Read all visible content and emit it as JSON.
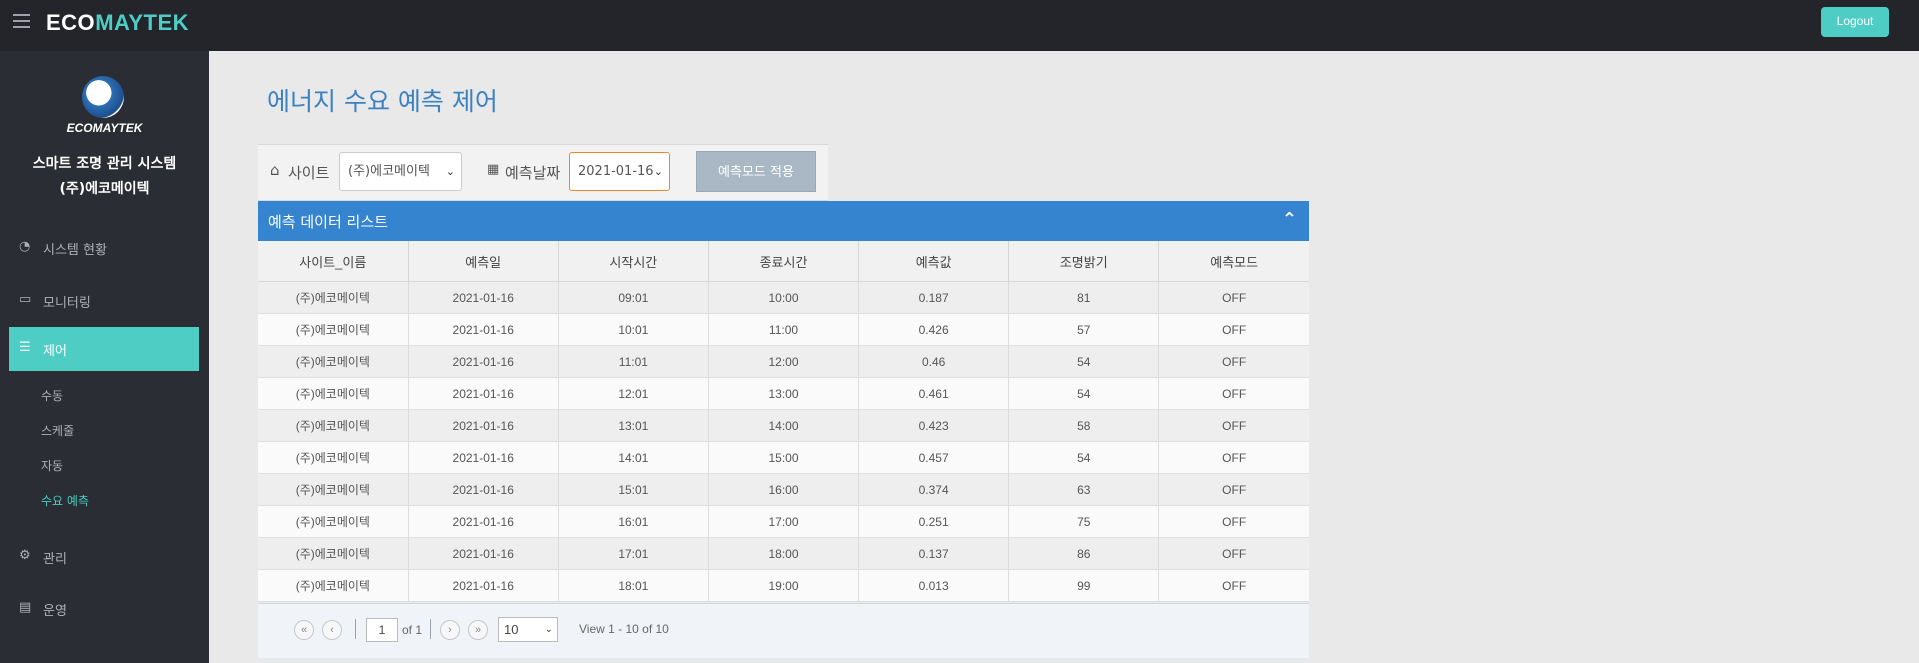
{
  "topbar": {
    "brand_eco": "ECO",
    "brand_maytek": "MAYTEK",
    "logout": "Logout"
  },
  "sidebar": {
    "logo_text": "ECOMAYTEK",
    "system_title": "스마트 조명 관리 시스템",
    "company": "(주)에코메이텍",
    "items": [
      {
        "label": "시스템 현황",
        "icon": "dashboard-icon"
      },
      {
        "label": "모니터링",
        "icon": "monitor-icon"
      },
      {
        "label": "제어",
        "icon": "tasks-icon"
      },
      {
        "label": "관리",
        "icon": "cogs-icon"
      },
      {
        "label": "운영",
        "icon": "book-icon"
      }
    ],
    "subitems": [
      {
        "label": "수동"
      },
      {
        "label": "스케줄"
      },
      {
        "label": "자동"
      },
      {
        "label": "수요 예측"
      }
    ]
  },
  "main": {
    "page_title": "에너지 수요 예측 제어",
    "filter": {
      "site_label": "사이트",
      "site_value": "(주)에코메이텍",
      "date_label": "예측날짜",
      "date_value": "2021-01-16",
      "apply": "예측모드 적용"
    },
    "panel_title": "예측 데이터 리스트",
    "columns": [
      "사이트_이름",
      "예측일",
      "시작시간",
      "종료시간",
      "예측값",
      "조명밝기",
      "예측모드"
    ],
    "rows": [
      [
        "(주)에코메이텍",
        "2021-01-16",
        "09:01",
        "10:00",
        "0.187",
        "81",
        "OFF"
      ],
      [
        "(주)에코메이텍",
        "2021-01-16",
        "10:01",
        "11:00",
        "0.426",
        "57",
        "OFF"
      ],
      [
        "(주)에코메이텍",
        "2021-01-16",
        "11:01",
        "12:00",
        "0.46",
        "54",
        "OFF"
      ],
      [
        "(주)에코메이텍",
        "2021-01-16",
        "12:01",
        "13:00",
        "0.461",
        "54",
        "OFF"
      ],
      [
        "(주)에코메이텍",
        "2021-01-16",
        "13:01",
        "14:00",
        "0.423",
        "58",
        "OFF"
      ],
      [
        "(주)에코메이텍",
        "2021-01-16",
        "14:01",
        "15:00",
        "0.457",
        "54",
        "OFF"
      ],
      [
        "(주)에코메이텍",
        "2021-01-16",
        "15:01",
        "16:00",
        "0.374",
        "63",
        "OFF"
      ],
      [
        "(주)에코메이텍",
        "2021-01-16",
        "16:01",
        "17:00",
        "0.251",
        "75",
        "OFF"
      ],
      [
        "(주)에코메이텍",
        "2021-01-16",
        "17:01",
        "18:00",
        "0.137",
        "86",
        "OFF"
      ],
      [
        "(주)에코메이텍",
        "2021-01-16",
        "18:01",
        "19:00",
        "0.013",
        "99",
        "OFF"
      ]
    ],
    "pager": {
      "page": "1",
      "of_text": "of 1",
      "page_size": "10",
      "view_text": "View 1 - 10 of 10"
    }
  },
  "colors": {
    "accent": "#4ecdc4",
    "primary": "#3584d0",
    "title": "#3c81c2",
    "sidebar": "#2a2d33",
    "topbar": "#23252b"
  }
}
